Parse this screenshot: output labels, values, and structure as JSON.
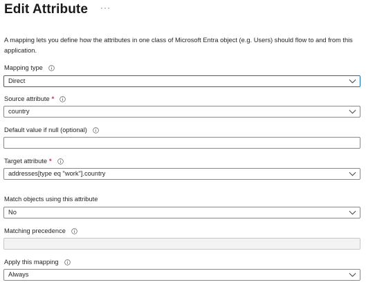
{
  "header": {
    "title": "Edit Attribute",
    "more_label": "···"
  },
  "description": "A mapping lets you define how the attributes in one class of Microsoft Entra object (e.g. Users) should flow to and from this application.",
  "fields": {
    "mapping_type": {
      "label": "Mapping type",
      "value": "Direct",
      "required": false
    },
    "source_attribute": {
      "label": "Source attribute",
      "value": "country",
      "required": true,
      "required_mark": "*"
    },
    "default_value": {
      "label": "Default value if null (optional)",
      "value": ""
    },
    "target_attribute": {
      "label": "Target attribute",
      "value": "addresses[type eq \"work\"].country",
      "required": true,
      "required_mark": "*"
    },
    "match_objects": {
      "label": "Match objects using this attribute",
      "value": "No"
    },
    "matching_precedence": {
      "label": "Matching precedence",
      "value": "",
      "disabled": true
    },
    "apply_mapping": {
      "label": "Apply this mapping",
      "value": "Always"
    }
  },
  "icons": {
    "info": "info-icon",
    "dropdown": "chevron-down-icon"
  },
  "colors": {
    "required": "#c4314b",
    "active_border": "#0f6cbd",
    "border": "#8a8886",
    "disabled_bg": "#f3f3f3"
  }
}
